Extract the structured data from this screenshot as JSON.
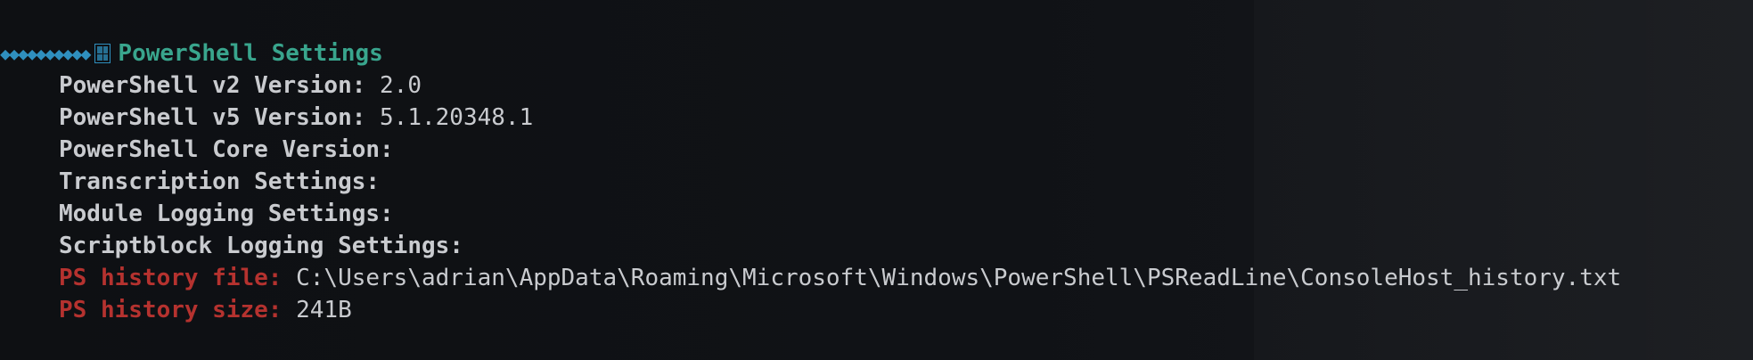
{
  "top_fragment": "",
  "section": {
    "title": "PowerShell Settings",
    "icon": "table-icon"
  },
  "items": [
    {
      "label": "PowerShell v2 Version:",
      "value": "2.0",
      "color": "#c9cbcf"
    },
    {
      "label": "PowerShell v5 Version:",
      "value": "5.1.20348.1",
      "color": "#c9cbcf"
    },
    {
      "label": "PowerShell Core Version:",
      "value": "",
      "color": "#c9cbcf"
    },
    {
      "label": "Transcription Settings:",
      "value": "",
      "color": "#c9cbcf"
    },
    {
      "label": "Module Logging Settings:",
      "value": "",
      "color": "#c9cbcf"
    },
    {
      "label": "Scriptblock Logging Settings:",
      "value": "",
      "color": "#c9cbcf"
    },
    {
      "label": "PS history file:",
      "value": "C:\\Users\\adrian\\AppData\\Roaming\\Microsoft\\Windows\\PowerShell\\PSReadLine\\ConsoleHost_history.txt",
      "color": "#b5322f"
    },
    {
      "label": "PS history size:",
      "value": "241B",
      "color": "#b5322f"
    }
  ],
  "colors": {
    "background": "#0f1114",
    "text": "#c9cbcf",
    "header": "#39a58d",
    "accent": "#2f8fbe",
    "warning": "#b5322f"
  }
}
